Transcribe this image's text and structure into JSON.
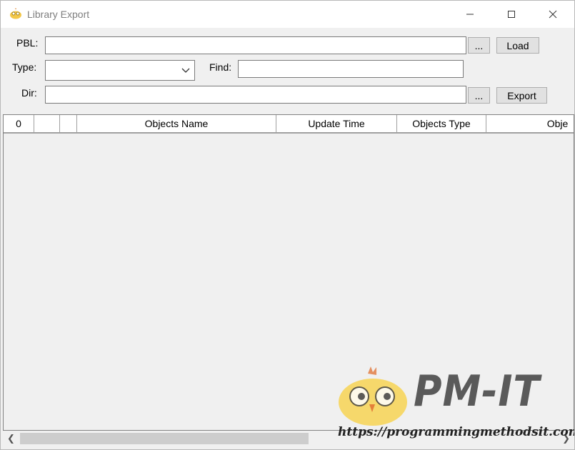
{
  "window": {
    "title": "Library Export",
    "icon": "chick-app-icon"
  },
  "form": {
    "pbl_label": "PBL:",
    "pbl_value": "",
    "pbl_browse_label": "...",
    "load_label": "Load",
    "type_label": "Type:",
    "type_value": "",
    "find_label": "Find:",
    "find_value": "",
    "dir_label": "Dir:",
    "dir_value": "",
    "dir_browse_label": "...",
    "export_label": "Export"
  },
  "table": {
    "columns": [
      "0",
      "",
      "",
      "Objects Name",
      "Update Time",
      "Objects Type",
      "Obje"
    ],
    "rows": []
  },
  "watermark": {
    "brand": "PM-IT",
    "url": "https://programmingmethodsit.com"
  },
  "colors": {
    "background": "#f0f0f0",
    "title_text": "#7f7f7f",
    "button_face": "#e1e1e1",
    "watermark_chick": "#f7d24a"
  }
}
